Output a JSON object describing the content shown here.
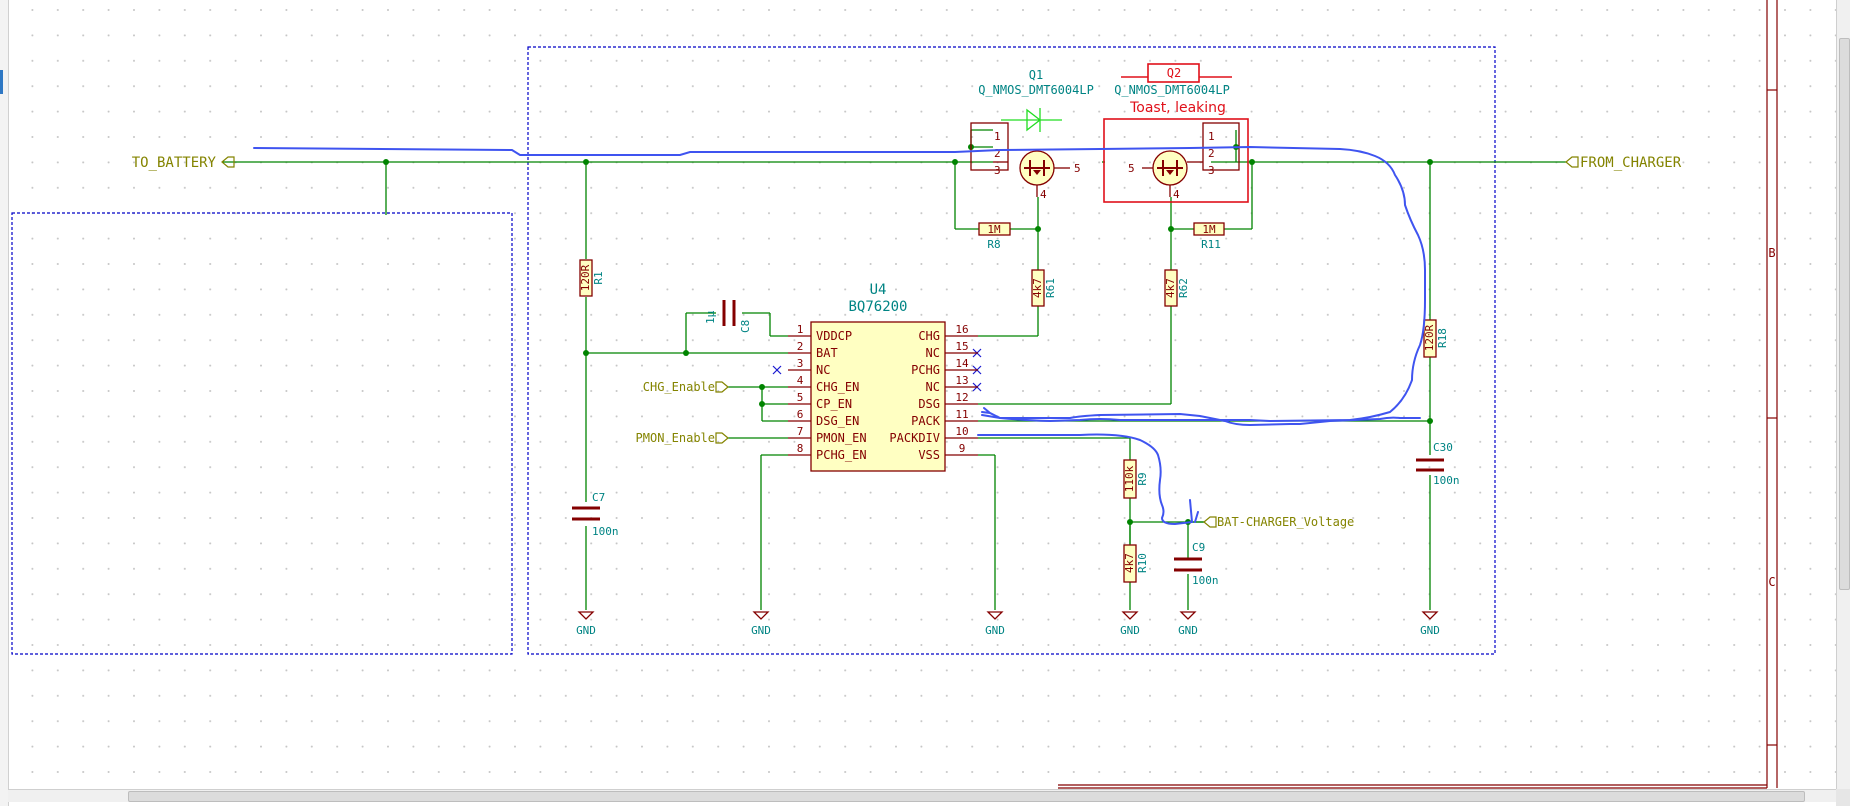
{
  "schematic": {
    "tags": {
      "to_battery": "TO_BATTERY",
      "from_charger": "FROM_CHARGER",
      "chg_enable": "CHG_Enable",
      "pmon_enable": "PMON_Enable",
      "bat_charger_voltage": "BAT-CHARGER_Voltage"
    },
    "ic": {
      "ref": "U4",
      "value": "BQ76200",
      "left_pins": [
        {
          "num": "1",
          "name": "VDDCP"
        },
        {
          "num": "2",
          "name": "BAT"
        },
        {
          "num": "3",
          "name": "NC"
        },
        {
          "num": "4",
          "name": "CHG_EN"
        },
        {
          "num": "5",
          "name": "CP_EN"
        },
        {
          "num": "6",
          "name": "DSG_EN"
        },
        {
          "num": "7",
          "name": "PMON_EN"
        },
        {
          "num": "8",
          "name": "PCHG_EN"
        }
      ],
      "right_pins": [
        {
          "num": "16",
          "name": "CHG"
        },
        {
          "num": "15",
          "name": "NC"
        },
        {
          "num": "14",
          "name": "PCHG"
        },
        {
          "num": "13",
          "name": "NC"
        },
        {
          "num": "12",
          "name": "DSG"
        },
        {
          "num": "11",
          "name": "PACK"
        },
        {
          "num": "10",
          "name": "PACKDIV"
        },
        {
          "num": "9",
          "name": "VSS"
        }
      ]
    },
    "q1": {
      "ref": "Q1",
      "value": "Q_NMOS_DMT6004LP",
      "pin1": "1",
      "pin2": "2",
      "pin3": "3",
      "pin4": "4",
      "pin5": "5"
    },
    "q2": {
      "ref": "Q2",
      "value": "Q_NMOS_DMT6004LP",
      "pin1": "1",
      "pin2": "2",
      "pin3": "3",
      "pin4": "4",
      "pin5": "5"
    },
    "annotation": "Toast, leaking",
    "resistors": {
      "r1": {
        "ref": "R1",
        "value": "120R"
      },
      "r8": {
        "ref": "R8",
        "value": "1M"
      },
      "r11": {
        "ref": "R11",
        "value": "1M"
      },
      "r61": {
        "ref": "R61",
        "value": "4k7"
      },
      "r62": {
        "ref": "R62",
        "value": "4k7"
      },
      "r18": {
        "ref": "R18",
        "value": "120R"
      },
      "r9": {
        "ref": "R9",
        "value": "110k"
      },
      "r10": {
        "ref": "R10",
        "value": "4k7"
      }
    },
    "capacitors": {
      "c8": {
        "ref": "C8",
        "value": "1μ"
      },
      "c7": {
        "ref": "C7",
        "value": "100n"
      },
      "c30": {
        "ref": "C30",
        "value": "100n"
      },
      "c9": {
        "ref": "C9",
        "value": "100n"
      }
    },
    "gnd_label": "GND",
    "border_markers": [
      "B",
      "C"
    ]
  },
  "colors": {
    "wire": "#008400",
    "part_body": "#840000",
    "part_fill": "#ffffc2",
    "pin_text": "#840000",
    "ref_text": "#008484",
    "label_text": "#848400",
    "sheet_box": "#0000c8",
    "markup_red": "#e0101a",
    "markup_green": "#22dd22",
    "markup_blue": "#3f54f0",
    "grid_dot": "#c8c8c8"
  }
}
